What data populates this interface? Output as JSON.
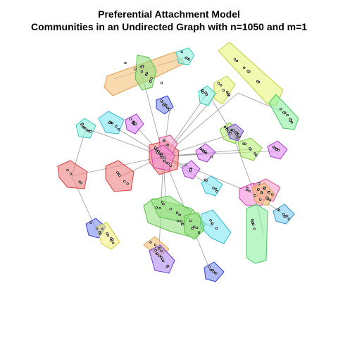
{
  "title": "Preferential Attachment Model",
  "subtitle": "Communities in an Undirected Graph with n=1050 and m=1",
  "graph": {
    "n": 1050,
    "m": 1,
    "directed": false,
    "communities": [
      {
        "id": "c01",
        "color": "#f5c27a",
        "stroke": "#e0a050"
      },
      {
        "id": "c02",
        "color": "#93e07f",
        "stroke": "#5cbf4a"
      },
      {
        "id": "c03",
        "color": "#8ef0e0",
        "stroke": "#3cc8b8"
      },
      {
        "id": "c04",
        "color": "#e6f57a",
        "stroke": "#c0d040"
      },
      {
        "id": "c05",
        "color": "#8cf0a0",
        "stroke": "#4cc868"
      },
      {
        "id": "c06",
        "color": "#7a8cf0",
        "stroke": "#3040d0"
      },
      {
        "id": "c07",
        "color": "#80e8f5",
        "stroke": "#38b8d0"
      },
      {
        "id": "c08",
        "color": "#e088f5",
        "stroke": "#a040c8"
      },
      {
        "id": "c09",
        "color": "#f08080",
        "stroke": "#d04040"
      },
      {
        "id": "c10",
        "color": "#f5a0c8",
        "stroke": "#d05090"
      },
      {
        "id": "c11",
        "color": "#b8f07a",
        "stroke": "#80c840"
      },
      {
        "id": "c12",
        "color": "#b08cf0",
        "stroke": "#7040d0"
      },
      {
        "id": "c13",
        "color": "#f590d8",
        "stroke": "#d040a8"
      },
      {
        "id": "c14",
        "color": "#80d0f5",
        "stroke": "#3890d0"
      },
      {
        "id": "c15",
        "color": "#f5f080",
        "stroke": "#d0c840"
      }
    ]
  }
}
